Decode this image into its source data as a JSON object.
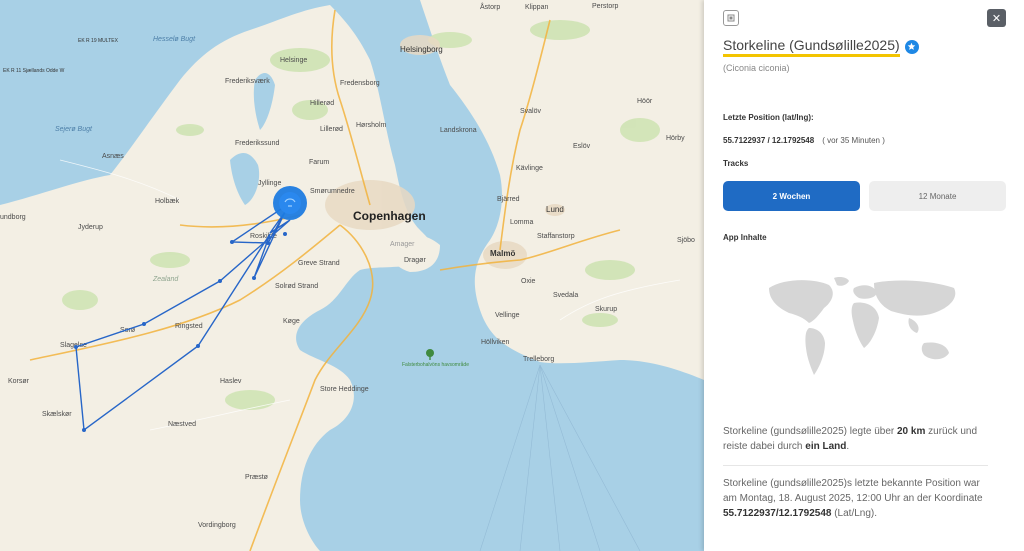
{
  "map": {
    "labels": {
      "copenhagen": "Copenhagen",
      "malmo": "Malmö",
      "helsingborg": "Helsingborg",
      "lund": "Lund",
      "roskilde": "Roskilde",
      "greve": "Greve Strand",
      "solrod": "Solrød Strand",
      "koge": "Køge",
      "ringsted": "Ringsted",
      "soro": "Sorø",
      "slagelse": "Slagelse",
      "korsor": "Korsør",
      "skaelskor": "Skælskør",
      "naestved": "Næstved",
      "haslev": "Haslev",
      "store_heddinge": "Store Heddinge",
      "praesto": "Præstø",
      "vordingborg": "Vordingborg",
      "holbaek": "Holbæk",
      "jyderup": "Jyderup",
      "asnaes": "Asnæs",
      "frederikssund": "Frederikssund",
      "frederiksvaerk": "Frederiksværk",
      "hillerod": "Hillerød",
      "fredensborg": "Fredensborg",
      "helsinge": "Helsinge",
      "horsholm": "Hørsholm",
      "lillerod": "Lillerød",
      "farum": "Farum",
      "jyllinge": "Jyllinge",
      "smorum": "Smørumnedre",
      "landskrona": "Landskrona",
      "kavlinge": "Kävlinge",
      "bjarred": "Bjärred",
      "lomma": "Lomma",
      "staffanstorp": "Staffanstorp",
      "svalov": "Svalöv",
      "eslov": "Eslöv",
      "hoor": "Höör",
      "horby": "Hörby",
      "sjobo": "Sjöbo",
      "oxie": "Oxie",
      "svedala": "Svedala",
      "skurup": "Skurup",
      "vellinge": "Vellinge",
      "hollviken": "Höllviken",
      "trelleborg": "Trelleborg",
      "dragor": "Dragør",
      "amager": "Amager",
      "klippan": "Klippan",
      "astorp": "Åstorp",
      "perstorp": "Perstorp",
      "zealand": "Zealand",
      "hesselo": "Hesselø Bugt",
      "sejero": "Sejerø Bugt",
      "falsterbo": "Falsterbohalvöns havsområde",
      "ekr19": "EK R 19 MULTEX",
      "ekr11": "EK R 11 Sjællands Odde W",
      "holbro": "undborg"
    }
  },
  "panel": {
    "close_icon": "close-icon",
    "title": "Storkeline (Gundsølille2025)",
    "latin": "(Ciconia ciconia)",
    "position_heading": "Letzte Position (lat/lng):",
    "coords": "55.7122937 / 12.1792548",
    "ago": "( vor 35 Minuten )",
    "tracks_heading": "Tracks",
    "btn_2w": "2 Wochen",
    "btn_12m": "12 Monate",
    "content_heading": "App Inhalte",
    "para1_pre": "Storkeline (gundsølille2025) legte über ",
    "para1_km": "20 km",
    "para1_mid": " zurück und reiste dabei durch ",
    "para1_land": "ein Land",
    "para1_post": ".",
    "para2_pre": "Storkeline (gundsølille2025)s letzte bekannte Position war am Montag, 18. August 2025, 12:00 Uhr an der Koordinate ",
    "para2_coord": "55.7122937/12.1792548",
    "para2_post": " (Lat/Lng).",
    "accent": "#1f6bc4",
    "highlight": "#f3c400"
  }
}
